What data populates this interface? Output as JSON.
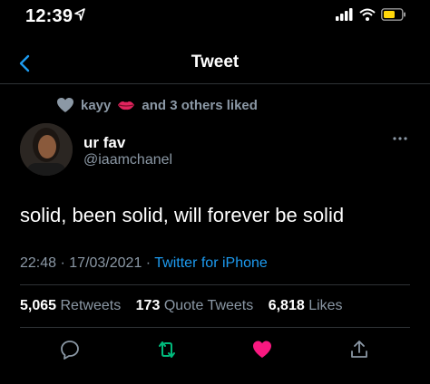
{
  "status": {
    "time": "12:39"
  },
  "nav": {
    "title": "Tweet"
  },
  "social_context": {
    "liker": "kayy",
    "rest": "and 3 others liked"
  },
  "author": {
    "display_name": "ur fav",
    "handle": "@iaamchanel"
  },
  "tweet": {
    "text": "solid, been solid, will forever be solid"
  },
  "meta": {
    "time": "22:48",
    "date": "17/03/2021",
    "source": "Twitter for iPhone"
  },
  "stats": {
    "retweets_count": "5,065",
    "retweets_label": "Retweets",
    "quotes_count": "173",
    "quotes_label": "Quote Tweets",
    "likes_count": "6,818",
    "likes_label": "Likes"
  },
  "colors": {
    "accent": "#1d9bf0",
    "retweet": "#00ba7c",
    "like": "#f91880",
    "muted": "#8b98a5"
  },
  "icons": [
    "location-arrow-icon",
    "signal-icon",
    "wifi-icon",
    "battery-icon",
    "back-chevron-icon",
    "heart-icon",
    "kiss-lips-icon",
    "more-icon",
    "reply-icon",
    "retweet-icon",
    "like-icon",
    "share-icon"
  ]
}
